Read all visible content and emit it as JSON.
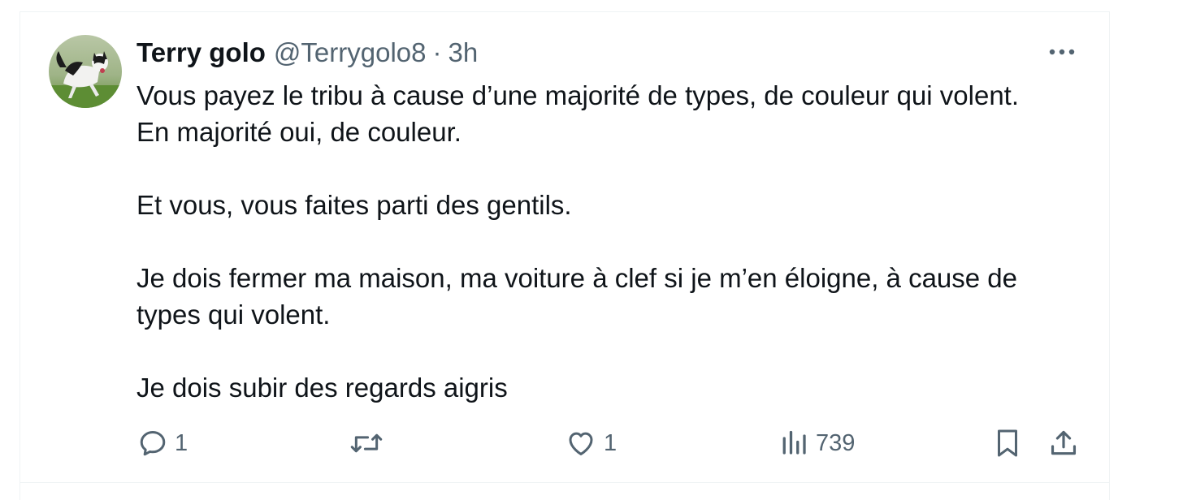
{
  "tweet": {
    "author_name": "Terry golo",
    "author_handle": "@Terrygolo8",
    "separator": "·",
    "timestamp": "3h",
    "avatar_icon": "dog-avatar",
    "more_icon": "more-horizontal-icon",
    "text_lines": [
      "Vous payez le tribu à cause d’une majorité de types, de couleur qui volent.",
      "En majorité oui, de couleur.",
      "",
      "Et vous, vous faites parti des gentils.",
      "",
      "Je dois fermer ma maison, ma voiture à clef si je m’en éloigne, à cause de types qui volent.",
      "",
      "Je dois subir des regards aigris"
    ]
  },
  "actions": {
    "reply": {
      "icon": "reply-icon",
      "count": "1"
    },
    "retweet": {
      "icon": "retweet-icon",
      "count": ""
    },
    "like": {
      "icon": "heart-icon",
      "count": "1"
    },
    "views": {
      "icon": "views-icon",
      "count": "739"
    },
    "bookmark": {
      "icon": "bookmark-icon"
    },
    "share": {
      "icon": "share-icon"
    }
  },
  "colors": {
    "text_primary": "#0f1419",
    "text_secondary": "#536471",
    "border": "#eff3f4"
  }
}
